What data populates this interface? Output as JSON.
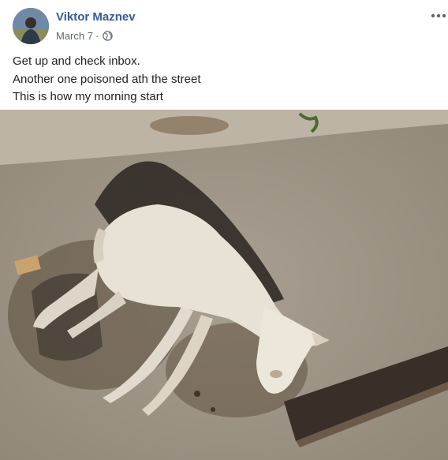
{
  "post": {
    "author_name": "Viktor Maznev",
    "date": "March 7",
    "separator": "·",
    "privacy_icon": "globe-icon",
    "more_icon": "more-options-icon",
    "text_lines": [
      "Get up and check inbox.",
      "Another one poisoned ath the street",
      "This is how my morning start"
    ]
  },
  "colors": {
    "author_link": "#385898",
    "meta_text": "#606770",
    "body_text": "#1c1e21"
  }
}
